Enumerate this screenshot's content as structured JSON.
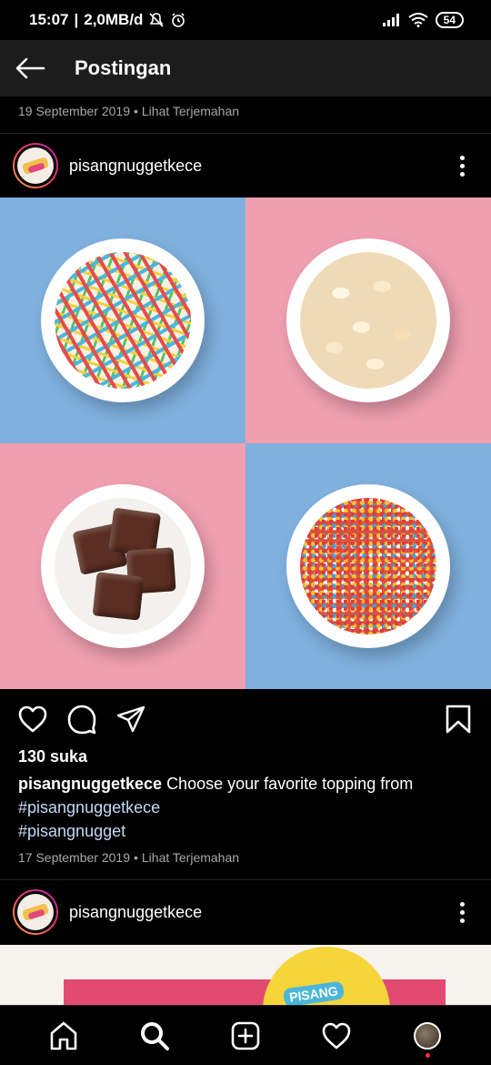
{
  "status_bar": {
    "time": "15:07",
    "network_speed": "2,0MB/d",
    "battery": "54"
  },
  "app_bar": {
    "title": "Postingan",
    "back_icon": "arrow-left-icon"
  },
  "previous_post": {
    "date": "19 September 2019",
    "translate_label": "Lihat Terjemahan"
  },
  "post": {
    "username": "pisangnuggetkece",
    "likes": "130 suka",
    "caption_user": "pisangnuggetkece",
    "caption_text": "Choose your favorite topping from",
    "hashtags": [
      "#pisangnuggetkece",
      "#pisangnugget"
    ],
    "date": "17 September 2019",
    "translate_label": "Lihat Terjemahan",
    "actions": [
      "heart-icon",
      "comment-icon",
      "share-icon",
      "bookmark-icon"
    ]
  },
  "next_post": {
    "username": "pisangnuggetkece",
    "image_brand_text": "PISANG"
  },
  "bottom_nav": [
    "home-icon",
    "search-icon",
    "add-icon",
    "heart-icon",
    "profile-avatar"
  ],
  "colors": {
    "background": "#000000",
    "hashtag": "#c3d8f5",
    "meta_text": "#a8a8a8",
    "panel_blue": "#7fb0de",
    "panel_pink": "#ef9fb0",
    "notification": "#ff3040"
  }
}
